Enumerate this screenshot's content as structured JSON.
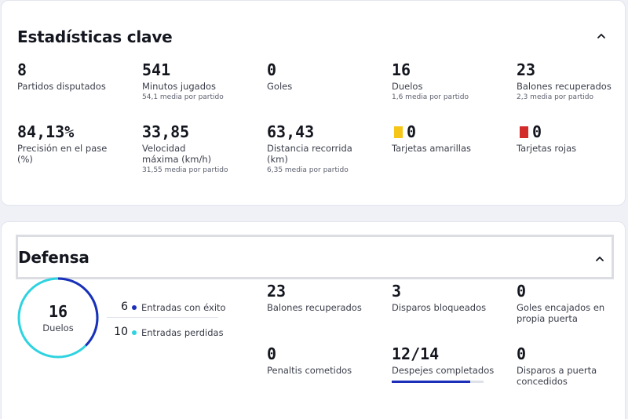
{
  "key_stats": {
    "title": "Estadísticas clave",
    "items": [
      {
        "value": "8",
        "label": "Partidos disputados",
        "sub": ""
      },
      {
        "value": "541",
        "label": "Minutos jugados",
        "sub": "54,1 media por partido"
      },
      {
        "value": "0",
        "label": "Goles",
        "sub": ""
      },
      {
        "value": "16",
        "label": "Duelos",
        "sub": "1,6 media por partido"
      },
      {
        "value": "23",
        "label": "Balones recuperados",
        "sub": "2,3 media por partido"
      },
      {
        "value": "84,13%",
        "label": "Precisión en el pase (%)",
        "sub": ""
      },
      {
        "value": "33,85",
        "label": "Velocidad máxima (km/h)",
        "sub": "31,55 media por partido"
      },
      {
        "value": "63,43",
        "label": "Distancia recorrida (km)",
        "sub": "6,35 media por partido"
      },
      {
        "value": "0",
        "label": "Tarjetas amarillas",
        "sub": "",
        "icon": "yellow-card-icon",
        "icon_color": "#f5c518"
      },
      {
        "value": "0",
        "label": "Tarjetas rojas",
        "sub": "",
        "icon": "red-card-icon",
        "icon_color": "#d32a2a"
      }
    ]
  },
  "defense": {
    "title": "Defensa",
    "ring": {
      "value": "16",
      "label": "Duelos",
      "won_fraction": 0.375,
      "won_color": "#1d2fb9",
      "lost_color": "#2ed3e0"
    },
    "legend": [
      {
        "count": "6",
        "label": "Entradas con éxito",
        "color": "#1d2fb9"
      },
      {
        "count": "10",
        "label": "Entradas perdidas",
        "color": "#2ed3e0"
      }
    ],
    "items": [
      {
        "value": "23",
        "label": "Balones recuperados"
      },
      {
        "value": "3",
        "label": "Disparos bloqueados"
      },
      {
        "value": "0",
        "label": "Goles encajados en propia puerta"
      },
      {
        "value": "0",
        "label": "Penaltis cometidos"
      },
      {
        "value": "12/14",
        "label": "Despejes completados",
        "progress": 0.857
      },
      {
        "value": "0",
        "label": "Disparos a puerta concedidos"
      }
    ]
  },
  "colors": {
    "accent": "#1d2fb9",
    "cyan": "#2ed3e0"
  }
}
